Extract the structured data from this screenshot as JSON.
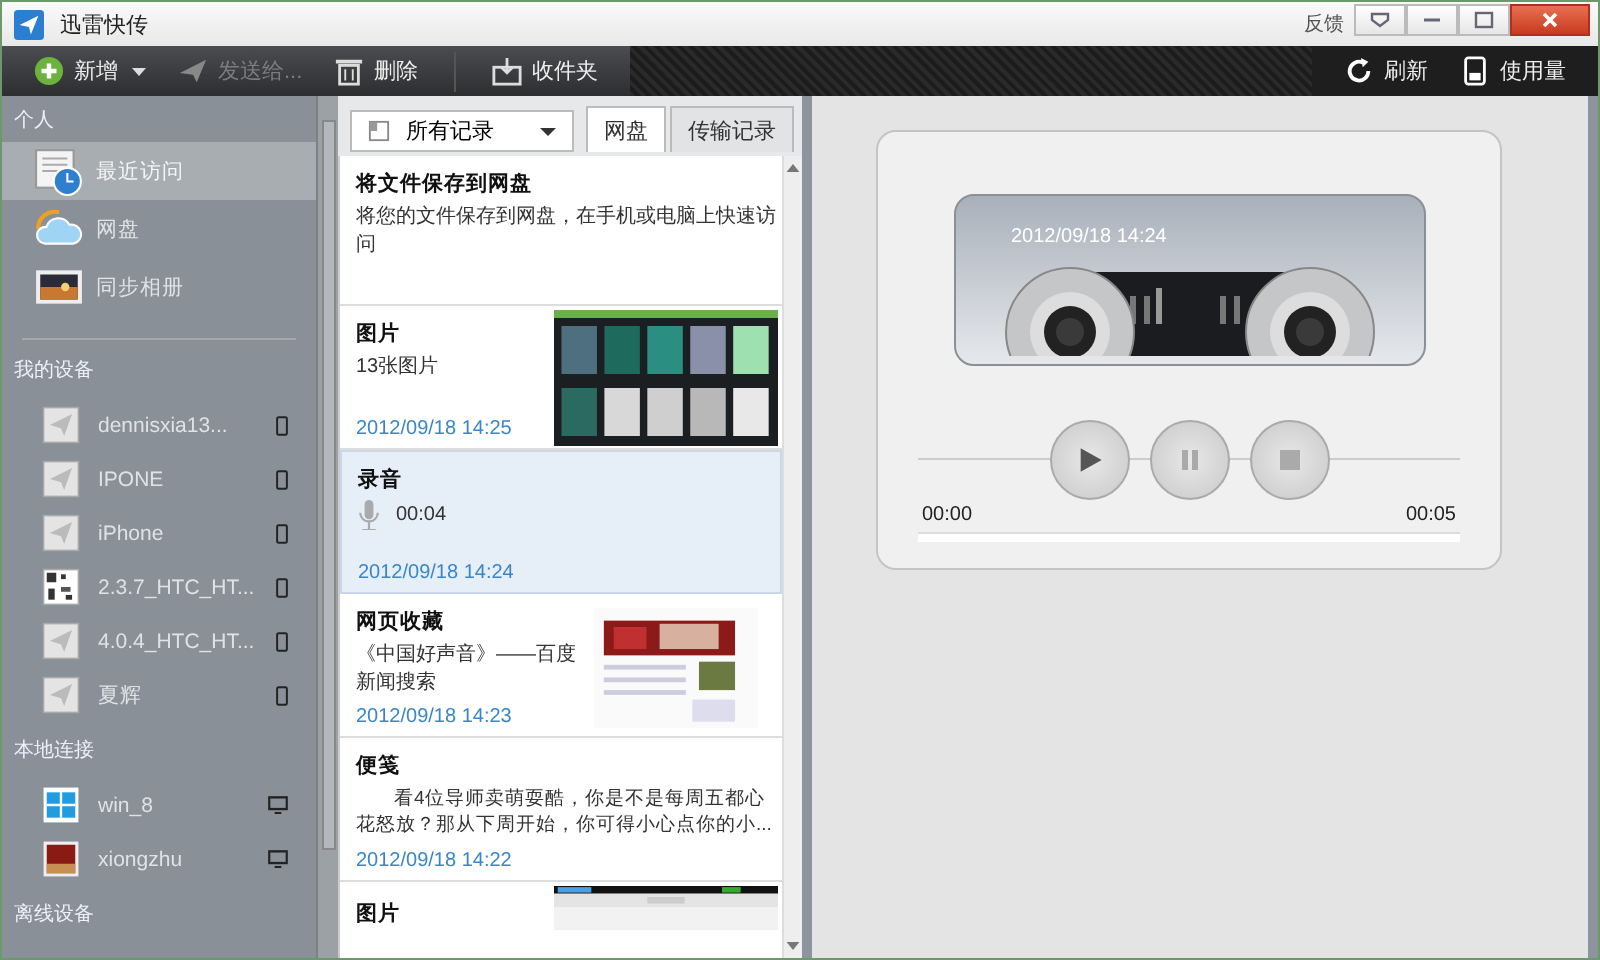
{
  "window": {
    "title": "迅雷快传",
    "feedback": "反馈"
  },
  "toolbar": {
    "left": [
      {
        "kind": "add",
        "label": "新增",
        "disabled": false
      },
      {
        "kind": "send",
        "label": "发送给...",
        "disabled": true
      },
      {
        "kind": "delete",
        "label": "删除",
        "disabled": false
      },
      {
        "kind": "inbox",
        "label": "收件夹",
        "disabled": false
      }
    ],
    "right": [
      {
        "kind": "refresh",
        "label": "刷新"
      },
      {
        "kind": "usage",
        "label": "使用量"
      }
    ]
  },
  "sidebar": {
    "sections": [
      {
        "title": "个人",
        "items": [
          {
            "kind": "place",
            "label": "最近访问",
            "selected": true
          },
          {
            "kind": "place",
            "label": "网盘",
            "selected": false
          },
          {
            "kind": "place",
            "label": "同步相册",
            "selected": false
          }
        ]
      },
      {
        "title": "我的设备",
        "items": [
          {
            "kind": "phone",
            "label": "dennisxia13...",
            "selected": false
          },
          {
            "kind": "phone",
            "label": "IPONE",
            "selected": false
          },
          {
            "kind": "phone",
            "label": "iPhone",
            "selected": false
          },
          {
            "kind": "phone",
            "label": "2.3.7_HTC_HT...",
            "selected": false
          },
          {
            "kind": "phone",
            "label": "4.0.4_HTC_HT...",
            "selected": false
          },
          {
            "kind": "phone",
            "label": "夏辉",
            "selected": false
          }
        ]
      },
      {
        "title": "本地连接",
        "items": [
          {
            "kind": "computer",
            "label": "win_8",
            "selected": false
          },
          {
            "kind": "computer",
            "label": "xiongzhu",
            "selected": false
          }
        ]
      },
      {
        "title": "离线设备"
      }
    ]
  },
  "middle": {
    "filter": "所有记录",
    "tabs": [
      {
        "label": "网盘",
        "selected": true
      },
      {
        "label": "传输记录",
        "selected": false
      }
    ],
    "records": [
      {
        "kind": "promo",
        "title": "将文件保存到网盘",
        "text": "将您的文件保存到网盘，在手机或电脑上快速访问",
        "selected": false
      },
      {
        "title": "图片",
        "text": "13张图片",
        "time": "2012/09/18  14:25",
        "selected": false
      },
      {
        "kind": "audio",
        "title": "录音",
        "text": "00:04",
        "time": "2012/09/18  14:24",
        "selected": true
      },
      {
        "kind": "web",
        "title": "网页收藏",
        "text": "《中国好声音》——百度新闻搜索",
        "time": "2012/09/18  14:23",
        "selected": false
      },
      {
        "kind": "note",
        "title": "便笺",
        "text": "看4位导师卖萌耍酷，你是不是每周五都心花怒放？那从下周开始，你可得小心点你的小...",
        "time": "2012/09/18  14:22",
        "selected": false
      },
      {
        "title": "图片",
        "selected": false
      }
    ]
  },
  "player": {
    "stamp": "2012/09/18  14:24",
    "start": "00:00",
    "end": "00:05",
    "level": 0
  }
}
